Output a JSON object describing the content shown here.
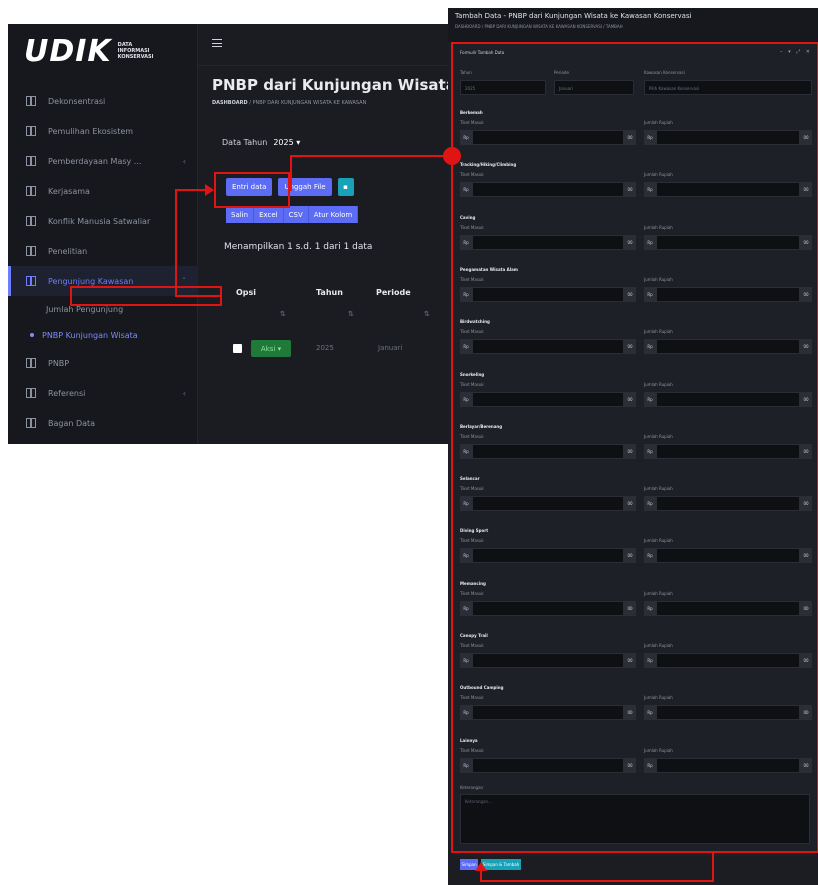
{
  "app": {
    "logo": {
      "main": "UDIK",
      "sub": [
        "DATA",
        "INFORMASI",
        "KONSERVASI"
      ]
    },
    "sidebar": {
      "items": [
        {
          "label": "Dekonsentrasi",
          "chevron": false
        },
        {
          "label": "Pemulihan Ekosistem",
          "chevron": false
        },
        {
          "label": "Pemberdayaan Masy ...",
          "chevron": true
        },
        {
          "label": "Kerjasama",
          "chevron": false
        },
        {
          "label": "Konflik Manusia Satwaliar",
          "chevron": false
        },
        {
          "label": "Penelitian",
          "chevron": false
        },
        {
          "label": "Pengunjung Kawasan",
          "chevron": true,
          "active": true
        },
        {
          "label": "Jumlah Pengunjung",
          "sub": true
        },
        {
          "label": "PNBP Kunjungan Wisata",
          "sub": true,
          "current": true
        },
        {
          "label": "PNBP",
          "chevron": false
        },
        {
          "label": "Referensi",
          "chevron": true
        },
        {
          "label": "Bagan Data",
          "chevron": false
        }
      ]
    },
    "page_title": "PNBP dari Kunjungan Wisata ke",
    "breadcrumb": {
      "home": "DASHBOARD",
      "rest": "/ PNBP DARI KUNJUNGAN WISATA KE KAWASAN"
    },
    "year": {
      "label": "Data Tahun",
      "value": "2025 ▾"
    },
    "buttons": {
      "add": "Entri data",
      "upload": "Unggah File",
      "export": [
        "Salin",
        "Excel",
        "CSV",
        "Atur Kolom"
      ]
    },
    "showing": "Menampilkan 1 s.d. 1 dari 1 data",
    "table": {
      "headers": [
        "Opsi",
        "Tahun",
        "Periode"
      ],
      "row": {
        "action": "Aksi ▾",
        "year": "2025",
        "period": "Januari"
      }
    }
  },
  "modal": {
    "title": "Tambah Data - PNBP dari Kunjungan Wisata ke Kawasan Konservasi",
    "breadcrumb": "DASHBOARD / PNBP DARI KUNJUNGAN WISATA KE KAWASAN KONSERVASI / TAMBAH",
    "card_title": "Formulir Tambah Data",
    "tools": "– ▾ ⤢ ✕",
    "top_fields": [
      {
        "label": "Tahun",
        "value": "2025"
      },
      {
        "label": "Periode",
        "value": "Januari"
      },
      {
        "label": "Kawasan Konservasi",
        "value": "Pilih Kawasan Konservasi"
      }
    ],
    "left_label": "Tiket Masuk",
    "right_label": "Jumlah Rupiah",
    "prefix": "Rp",
    "suffix": "00",
    "sections": [
      "Berkemah",
      "Tracking/Hiking/Climbing",
      "Caving",
      "Pengamatan Wisata Alam",
      "Birdwatching",
      "Snorkeling",
      "Berlayar/Berenang",
      "Selancar",
      "Diving Sport",
      "Memancing",
      "Canopy Trail",
      "Outbound Camping",
      "Lainnya"
    ],
    "notes_label": "Keterangan",
    "notes_placeholder": "Keterangan...",
    "save": "Simpan",
    "save_new": "Simpan & Tambah"
  },
  "colors": {
    "annotation": "#e11414",
    "primary": "#5c6cf5",
    "info": "#17a2b8",
    "background": "#1a1c22"
  }
}
